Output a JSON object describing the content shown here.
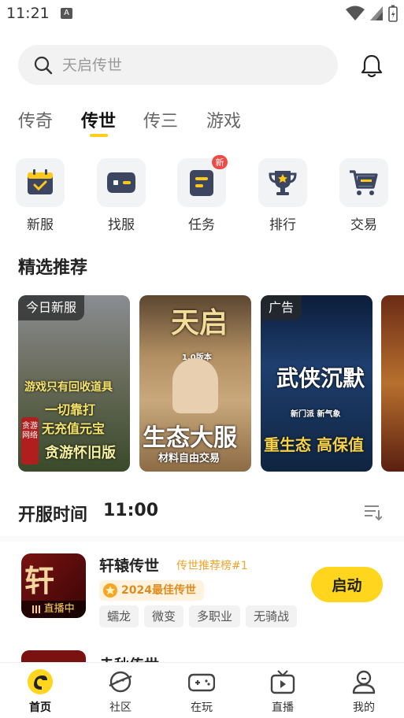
{
  "status_bar": {
    "time": "11:21",
    "notification_letter": "A"
  },
  "search": {
    "placeholder": "天启传世"
  },
  "tabs": [
    {
      "label": "传奇"
    },
    {
      "label": "传世"
    },
    {
      "label": "传三"
    },
    {
      "label": "游戏"
    }
  ],
  "active_tab": "传世",
  "quick_actions": [
    {
      "label": "新服",
      "icon": "calendar-check-icon"
    },
    {
      "label": "找服",
      "icon": "gamepad-icon"
    },
    {
      "label": "任务",
      "icon": "task-list-icon",
      "badge": "新"
    },
    {
      "label": "排行",
      "icon": "trophy-icon"
    },
    {
      "label": "交易",
      "icon": "cart-icon"
    }
  ],
  "featured": {
    "title": "精选推荐",
    "cards": [
      {
        "tag": "今日新服",
        "lines": [
          "游戏只有回收道具",
          "一切靠打",
          "无充值元宝"
        ],
        "footer": "贪游怀旧版",
        "side": "贪游网络"
      },
      {
        "tag": "",
        "title": "天启",
        "subtitle": "1.0版本",
        "footer": "生态大服",
        "footer2": "材料自由交易"
      },
      {
        "tag": "广告",
        "title": "武侠沉默",
        "subtitle": "新门派 新气象",
        "footer": "重生态 高保值"
      }
    ]
  },
  "open_server": {
    "title": "开服时间",
    "time": "11:00"
  },
  "games": [
    {
      "name": "轩辕传世",
      "rank": "传世推荐榜#1",
      "award": "2024最佳传世",
      "tags": [
        "蠕龙",
        "微变",
        "多职业",
        "无骑战"
      ],
      "live": "直播中",
      "icon_text": "轩",
      "button": "启动"
    }
  ],
  "peek_game": {
    "name": "赤秋传世"
  },
  "bottom_nav": [
    {
      "label": "首页",
      "icon": "home-icon"
    },
    {
      "label": "社区",
      "icon": "planet-icon"
    },
    {
      "label": "在玩",
      "icon": "controller-icon"
    },
    {
      "label": "直播",
      "icon": "tv-icon"
    },
    {
      "label": "我的",
      "icon": "user-icon"
    }
  ],
  "colors": {
    "accent": "#ffd51e",
    "badge_red": "#f04a45",
    "rank_orange": "#f0a429"
  }
}
